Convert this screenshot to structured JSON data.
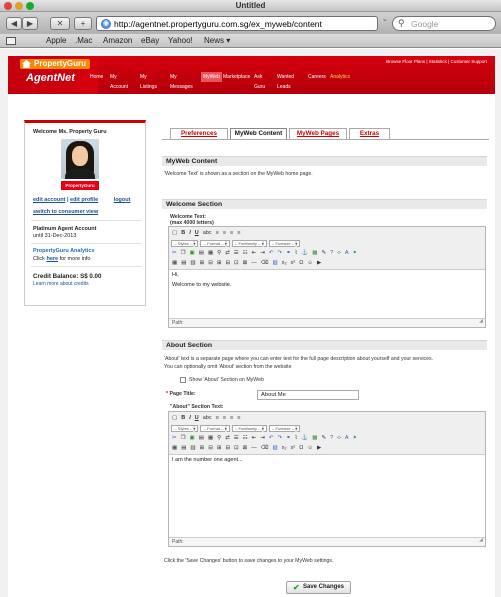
{
  "window": {
    "title": "Untitled"
  },
  "browser": {
    "url": "http://agentnet.propertyguru.com.sg/ex_myweb/content",
    "search_placeholder": "Google",
    "back_label": "◀",
    "forward_label": "▶",
    "close_label": "✕",
    "add_label": "+",
    "bookmarks": [
      "Apple",
      ".Mac",
      "Amazon",
      "eBay",
      "Yahoo!",
      "News ▾"
    ]
  },
  "header": {
    "logo_text": "PropertyGuru",
    "brand": "AgentNet",
    "top_links": "Browse Floor Plans | Statistics | Customer Support",
    "nav": [
      "Home",
      "My Account",
      "My Listings",
      "My Messages",
      "MyWeb",
      "Marketplace",
      "Ask Guru",
      "Wanted Leads",
      "Careers",
      "Analytics"
    ]
  },
  "sidebar": {
    "welcome": "Welcome Ms. Property Guru",
    "badge_text": "PropertyGuru",
    "edit_account": "edit account",
    "edit_profile": "edit profile",
    "divider": "|",
    "logout": "logout",
    "switch": "switch to consumer view",
    "account_type": "Platinum Agent Account",
    "account_until": "until 31-Dec-2013",
    "analytics_title": "PropertyGuru Analytics",
    "analytics_click": "Click",
    "analytics_here": "here",
    "analytics_more": "for more info",
    "credit_label": "Credit Balance: S$ 0.00",
    "credit_link": "Learn more about credits"
  },
  "tabs": [
    "Preferences",
    "MyWeb Content",
    "MyWeb Pages",
    "Extras"
  ],
  "myweb_content": {
    "heading": "MyWeb Content",
    "desc": "'Welcome Text' is shown as a section on the MyWeb home page."
  },
  "welcome_section": {
    "heading": "Welcome Section",
    "label": "Welcome Text:",
    "limit": "(max 4000 letters)",
    "line1": "Hi,",
    "line2": "Welcome to my website.",
    "path": "Path:"
  },
  "about_section": {
    "heading": "About Section",
    "desc1": "'About' text is a separate page where you can enter text for the full page description about yourself and your services.",
    "desc2": "You can optionally omit 'About' section from the website",
    "checkbox_label": "Show 'About' Section on MyWeb",
    "asterisk": "*",
    "page_title_label": "Page Title:",
    "page_title_value": "About Me",
    "text_label": "\"About\" Section Text:",
    "body": "I am the number one agent...",
    "path": "Path:"
  },
  "editor_toolbar": {
    "styles": "-- Styles --",
    "format": "-- Format --",
    "font_family": "-- Fontfamily --",
    "font_size": "-- Fontsize --"
  },
  "footer": {
    "hint": "Click the 'Save Changes' button to save changes to your MyWeb settings.",
    "save_label": "Save Changes"
  }
}
